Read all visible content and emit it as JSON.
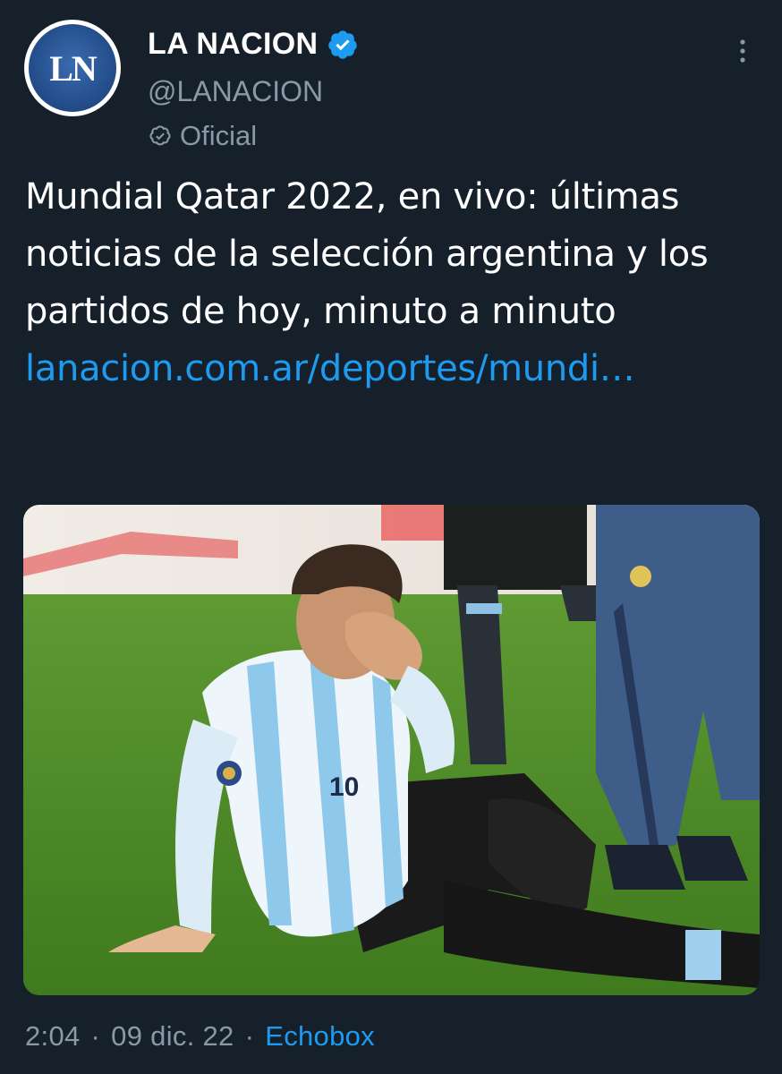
{
  "account": {
    "avatar_text": "LN",
    "display_name": "LA NACION",
    "handle": "@LANACION",
    "label": "Oficial"
  },
  "tweet": {
    "text": "Mundial Qatar 2022, en vivo: últimas noticias de la selección argentina y los partidos de hoy, minuto a minuto ",
    "link": "lanacion.com.ar/deportes/mundi…"
  },
  "meta": {
    "time": "2:04",
    "separator": "·",
    "date": "09 dic. 22",
    "source": "Echobox"
  },
  "media": {
    "jersey_number": "10"
  },
  "colors": {
    "background": "#15202b",
    "link": "#1d9bf0",
    "secondary_text": "#8b98a5",
    "verified": "#1d9bf0"
  }
}
